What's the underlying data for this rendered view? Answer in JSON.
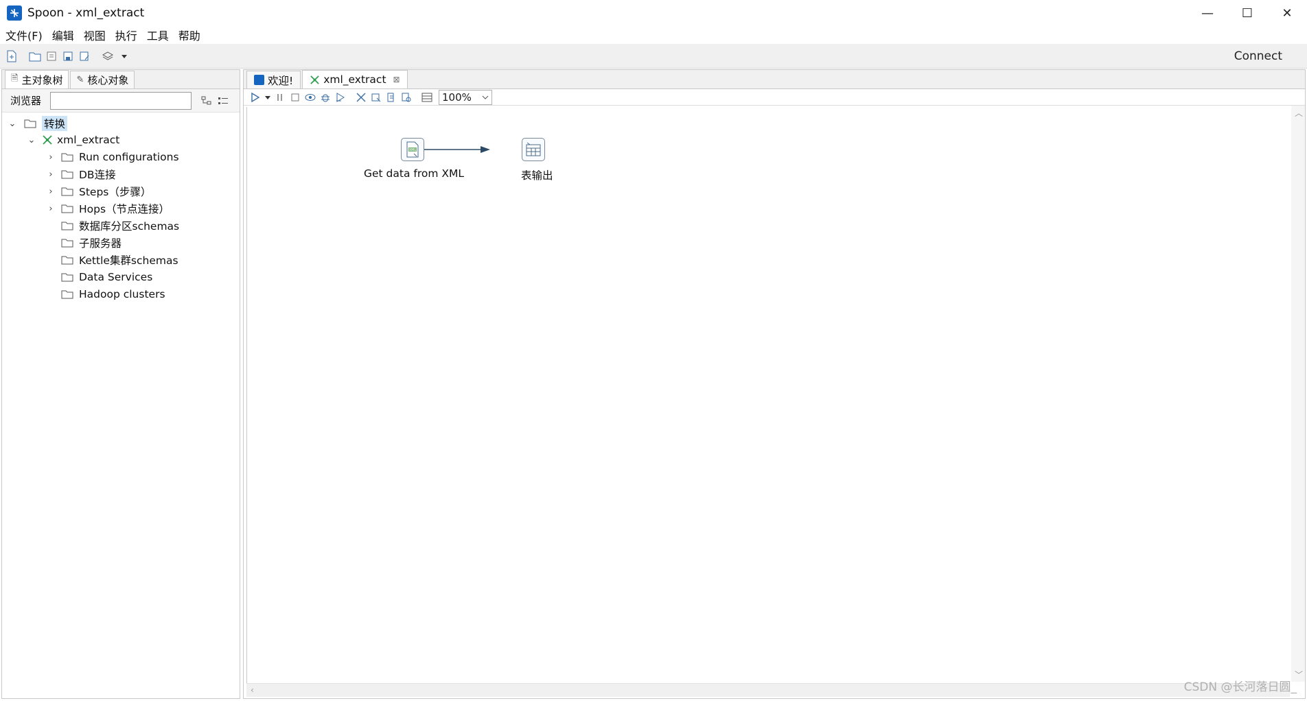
{
  "window": {
    "title": "Spoon - xml_extract",
    "minimize": "—",
    "maximize": "☐",
    "close": "✕"
  },
  "menu": {
    "items": [
      "文件(F)",
      "编辑",
      "视图",
      "执行",
      "工具",
      "帮助"
    ]
  },
  "toolbar": {
    "connect_label": "Connect"
  },
  "left_panel": {
    "tabs": [
      {
        "label": "主对象树",
        "icon": "document-icon"
      },
      {
        "label": "核心对象",
        "icon": "pencil-icon"
      }
    ],
    "browser_label": "浏览器",
    "browser_value": "",
    "tree": {
      "root": "转换",
      "transformation": "xml_extract",
      "children": [
        "Run configurations",
        "DB连接",
        "Steps（步骤）",
        "Hops（节点连接）",
        "数据库分区schemas",
        "子服务器",
        "Kettle集群schemas",
        "Data Services",
        "Hadoop clusters"
      ]
    }
  },
  "right_panel": {
    "tabs": [
      {
        "label": "欢迎!"
      },
      {
        "label": "xml_extract",
        "close": "⊠"
      }
    ],
    "zoom": "100%",
    "steps": [
      {
        "label": "Get data from XML",
        "icon": "xml-input-icon"
      },
      {
        "label": "表输出",
        "icon": "table-output-icon"
      }
    ]
  },
  "watermark": "CSDN @长河落日圆_",
  "colors": {
    "accent": "#1565c0",
    "selection": "#cce4f7",
    "hop_arrow": "#2c4a66",
    "transform_icon": "#2e9e4f"
  }
}
